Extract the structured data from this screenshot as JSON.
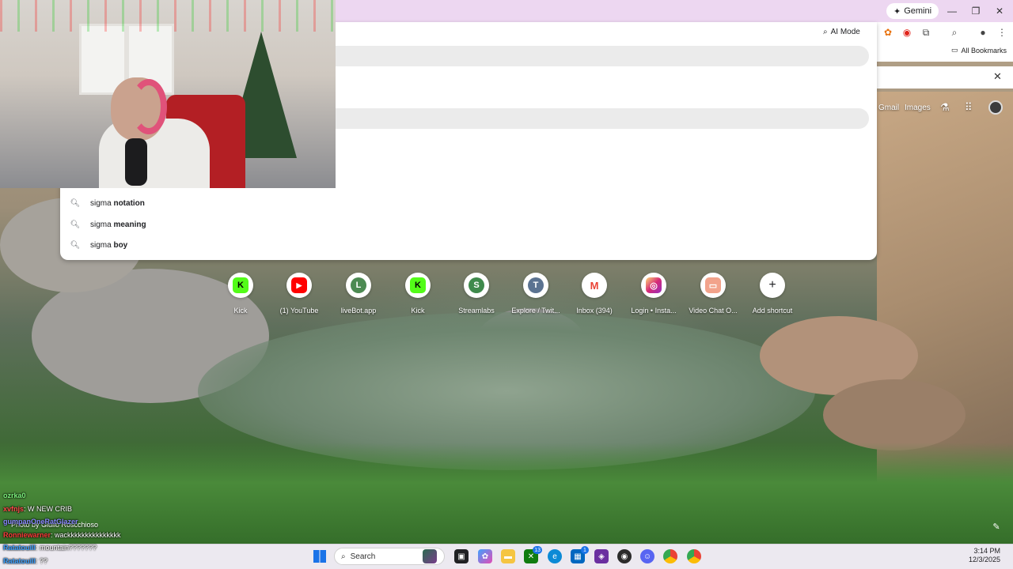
{
  "browser": {
    "gemini_label": "Gemini",
    "ai_mode_label": "AI Mode",
    "all_bookmarks_label": "All Bookmarks",
    "window_controls": {
      "minimize": "—",
      "restore": "❐",
      "close": "✕"
    }
  },
  "google_links": {
    "gmail": "Gmail",
    "images": "Images"
  },
  "search": {
    "suggestions": [
      {
        "prefix": "sigma",
        "completion": "notation"
      },
      {
        "prefix": "sigma",
        "completion": "meaning"
      },
      {
        "prefix": "sigma",
        "completion": "boy"
      }
    ]
  },
  "shortcuts": [
    {
      "label": "Kick",
      "glyph": "K",
      "color": "#53fc18",
      "glyph_color": "#000000"
    },
    {
      "label": "(1) YouTube",
      "glyph": "▶",
      "color": "#ff0000",
      "glyph_color": "#ffffff"
    },
    {
      "label": "liveBot.app",
      "glyph": "L",
      "color": "#4c8a52",
      "glyph_color": "#ffffff"
    },
    {
      "label": "Kick",
      "glyph": "K",
      "color": "#53fc18",
      "glyph_color": "#000000"
    },
    {
      "label": "Streamlabs",
      "glyph": "S",
      "color": "#3f8a4c",
      "glyph_color": "#ffffff"
    },
    {
      "label": "Explore / Twit...",
      "glyph": "T",
      "color": "#5b7391",
      "glyph_color": "#ffffff"
    },
    {
      "label": "Inbox (394)",
      "glyph": "M",
      "color": "#ffffff",
      "glyph_color": "#ea4335"
    },
    {
      "label": "Login • Insta...",
      "glyph": "◎",
      "color": "#c13584",
      "glyph_color": "#ffffff"
    },
    {
      "label": "Video Chat O...",
      "glyph": "▭",
      "color": "#f2a38b",
      "glyph_color": "#ffffff"
    },
    {
      "label": "Add shortcut",
      "glyph": "+",
      "color": "#ffffff",
      "glyph_color": "#202124"
    }
  ],
  "photo_credit": "Photo by Giulio Roscchioso",
  "chat": [
    {
      "user": "ozrka0",
      "message": "",
      "user_color": "#7cf27c"
    },
    {
      "user": "xvfnjs",
      "message": ": W NEW CRIB",
      "user_color": "#ff4a4a"
    },
    {
      "user": "gumpanOneRatGlazer",
      "message": "",
      "user_color": "#8a8aff"
    },
    {
      "user": "Ronniewarner",
      "message": ": wackkkkkkkkkkkkkkk",
      "user_color": "#ff3b3b"
    },
    {
      "user": "Ratatouill",
      "message": ": mountain???????",
      "user_color": "#3aa0ff"
    },
    {
      "user": "Ratatouill",
      "message": ": ??",
      "user_color": "#3aa0ff"
    }
  ],
  "taskbar": {
    "search_label": "Search",
    "time": "3:14 PM",
    "date": "12/3/2025",
    "badges": {
      "xbox": "13",
      "store": "1"
    }
  }
}
